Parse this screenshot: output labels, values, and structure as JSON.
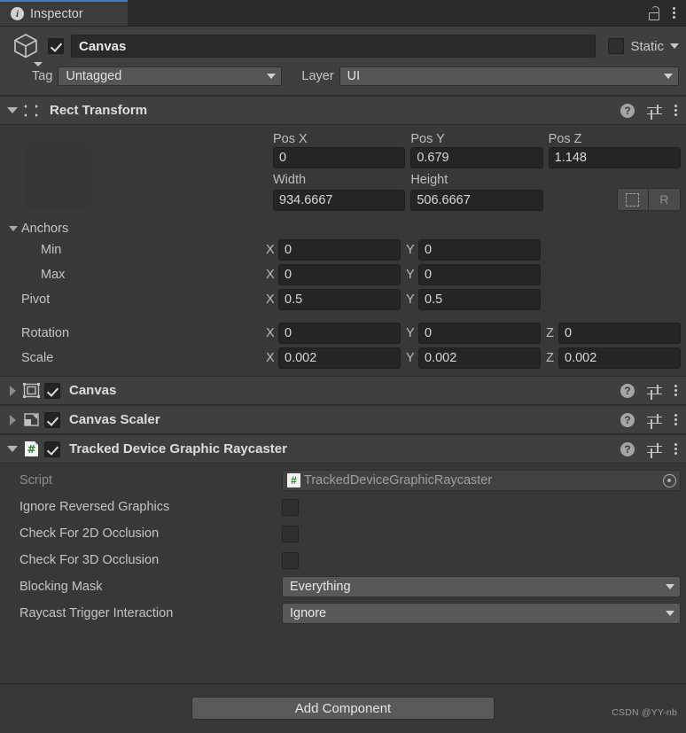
{
  "tab": {
    "label": "Inspector",
    "icon": "info-icon",
    "lock_icon": "unlocked-padlock-icon",
    "menu_icon": "kebab-menu-icon"
  },
  "object_header": {
    "enabled": true,
    "name": "Canvas",
    "static_label": "Static",
    "static_checked": false,
    "tag_label": "Tag",
    "tag_value": "Untagged",
    "layer_label": "Layer",
    "layer_value": "UI"
  },
  "rect_transform": {
    "title": "Rect Transform",
    "expanded": true,
    "pos_labels": [
      "Pos X",
      "Pos Y",
      "Pos Z"
    ],
    "pos_values": [
      "0",
      "0.679",
      "1.148"
    ],
    "size_labels": [
      "Width",
      "Height"
    ],
    "size_values": [
      "934.6667",
      "506.6667"
    ],
    "blueprint_button": "blueprint-mode",
    "raw_button": "R",
    "anchors_label": "Anchors",
    "min_label": "Min",
    "min": {
      "x": "0",
      "y": "0"
    },
    "max_label": "Max",
    "max": {
      "x": "0",
      "y": "0"
    },
    "pivot_label": "Pivot",
    "pivot": {
      "x": "0.5",
      "y": "0.5"
    },
    "rotation_label": "Rotation",
    "rotation": {
      "x": "0",
      "y": "0",
      "z": "0"
    },
    "scale_label": "Scale",
    "scale": {
      "x": "0.002",
      "y": "0.002",
      "z": "0.002"
    },
    "axis_x": "X",
    "axis_y": "Y",
    "axis_z": "Z"
  },
  "components": [
    {
      "title": "Canvas",
      "expanded": false,
      "enabled": true,
      "icon": "canvas-icon"
    },
    {
      "title": "Canvas Scaler",
      "expanded": false,
      "enabled": true,
      "icon": "canvas-scaler-icon"
    },
    {
      "title": "Tracked Device Graphic Raycaster",
      "expanded": true,
      "enabled": true,
      "icon": "cs-script-icon"
    }
  ],
  "raycaster": {
    "script_label": "Script",
    "script_value": "TrackedDeviceGraphicRaycaster",
    "rows": [
      {
        "label": "Ignore Reversed Graphics",
        "type": "checkbox",
        "checked": false
      },
      {
        "label": "Check For 2D Occlusion",
        "type": "checkbox",
        "checked": false
      },
      {
        "label": "Check For 3D Occlusion",
        "type": "checkbox",
        "checked": false
      },
      {
        "label": "Blocking Mask",
        "type": "dropdown",
        "value": "Everything"
      },
      {
        "label": "Raycast Trigger Interaction",
        "type": "dropdown",
        "value": "Ignore"
      }
    ]
  },
  "footer": {
    "add_component_label": "Add Component",
    "watermark": "CSDN @YY-nb"
  },
  "colors": {
    "window_bg": "#383838",
    "header_bg": "#3f3f3f",
    "tab_active": "#3b3b3b",
    "tab_accent": "#3b7bbf",
    "field_bg": "#252525",
    "dropdown_bg": "#585858",
    "text": "#c4c4c4",
    "script_green": "#2e7d32"
  }
}
